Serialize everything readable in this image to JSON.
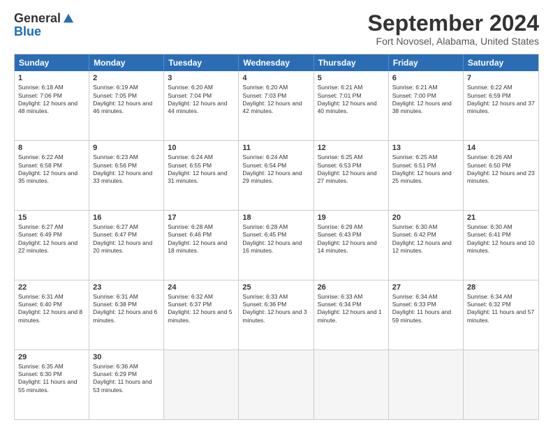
{
  "logo": {
    "general": "General",
    "blue": "Blue"
  },
  "title": "September 2024",
  "location": "Fort Novosel, Alabama, United States",
  "days": [
    "Sunday",
    "Monday",
    "Tuesday",
    "Wednesday",
    "Thursday",
    "Friday",
    "Saturday"
  ],
  "rows": [
    [
      {
        "day": "1",
        "sunrise": "Sunrise: 6:18 AM",
        "sunset": "Sunset: 7:06 PM",
        "daylight": "Daylight: 12 hours and 48 minutes."
      },
      {
        "day": "2",
        "sunrise": "Sunrise: 6:19 AM",
        "sunset": "Sunset: 7:05 PM",
        "daylight": "Daylight: 12 hours and 46 minutes."
      },
      {
        "day": "3",
        "sunrise": "Sunrise: 6:20 AM",
        "sunset": "Sunset: 7:04 PM",
        "daylight": "Daylight: 12 hours and 44 minutes."
      },
      {
        "day": "4",
        "sunrise": "Sunrise: 6:20 AM",
        "sunset": "Sunset: 7:03 PM",
        "daylight": "Daylight: 12 hours and 42 minutes."
      },
      {
        "day": "5",
        "sunrise": "Sunrise: 6:21 AM",
        "sunset": "Sunset: 7:01 PM",
        "daylight": "Daylight: 12 hours and 40 minutes."
      },
      {
        "day": "6",
        "sunrise": "Sunrise: 6:21 AM",
        "sunset": "Sunset: 7:00 PM",
        "daylight": "Daylight: 12 hours and 38 minutes."
      },
      {
        "day": "7",
        "sunrise": "Sunrise: 6:22 AM",
        "sunset": "Sunset: 6:59 PM",
        "daylight": "Daylight: 12 hours and 37 minutes."
      }
    ],
    [
      {
        "day": "8",
        "sunrise": "Sunrise: 6:22 AM",
        "sunset": "Sunset: 6:58 PM",
        "daylight": "Daylight: 12 hours and 35 minutes."
      },
      {
        "day": "9",
        "sunrise": "Sunrise: 6:23 AM",
        "sunset": "Sunset: 6:56 PM",
        "daylight": "Daylight: 12 hours and 33 minutes."
      },
      {
        "day": "10",
        "sunrise": "Sunrise: 6:24 AM",
        "sunset": "Sunset: 6:55 PM",
        "daylight": "Daylight: 12 hours and 31 minutes."
      },
      {
        "day": "11",
        "sunrise": "Sunrise: 6:24 AM",
        "sunset": "Sunset: 6:54 PM",
        "daylight": "Daylight: 12 hours and 29 minutes."
      },
      {
        "day": "12",
        "sunrise": "Sunrise: 6:25 AM",
        "sunset": "Sunset: 6:53 PM",
        "daylight": "Daylight: 12 hours and 27 minutes."
      },
      {
        "day": "13",
        "sunrise": "Sunrise: 6:25 AM",
        "sunset": "Sunset: 6:51 PM",
        "daylight": "Daylight: 12 hours and 25 minutes."
      },
      {
        "day": "14",
        "sunrise": "Sunrise: 6:26 AM",
        "sunset": "Sunset: 6:50 PM",
        "daylight": "Daylight: 12 hours and 23 minutes."
      }
    ],
    [
      {
        "day": "15",
        "sunrise": "Sunrise: 6:27 AM",
        "sunset": "Sunset: 6:49 PM",
        "daylight": "Daylight: 12 hours and 22 minutes."
      },
      {
        "day": "16",
        "sunrise": "Sunrise: 6:27 AM",
        "sunset": "Sunset: 6:47 PM",
        "daylight": "Daylight: 12 hours and 20 minutes."
      },
      {
        "day": "17",
        "sunrise": "Sunrise: 6:28 AM",
        "sunset": "Sunset: 6:46 PM",
        "daylight": "Daylight: 12 hours and 18 minutes."
      },
      {
        "day": "18",
        "sunrise": "Sunrise: 6:28 AM",
        "sunset": "Sunset: 6:45 PM",
        "daylight": "Daylight: 12 hours and 16 minutes."
      },
      {
        "day": "19",
        "sunrise": "Sunrise: 6:29 AM",
        "sunset": "Sunset: 6:43 PM",
        "daylight": "Daylight: 12 hours and 14 minutes."
      },
      {
        "day": "20",
        "sunrise": "Sunrise: 6:30 AM",
        "sunset": "Sunset: 6:42 PM",
        "daylight": "Daylight: 12 hours and 12 minutes."
      },
      {
        "day": "21",
        "sunrise": "Sunrise: 6:30 AM",
        "sunset": "Sunset: 6:41 PM",
        "daylight": "Daylight: 12 hours and 10 minutes."
      }
    ],
    [
      {
        "day": "22",
        "sunrise": "Sunrise: 6:31 AM",
        "sunset": "Sunset: 6:40 PM",
        "daylight": "Daylight: 12 hours and 8 minutes."
      },
      {
        "day": "23",
        "sunrise": "Sunrise: 6:31 AM",
        "sunset": "Sunset: 6:38 PM",
        "daylight": "Daylight: 12 hours and 6 minutes."
      },
      {
        "day": "24",
        "sunrise": "Sunrise: 6:32 AM",
        "sunset": "Sunset: 6:37 PM",
        "daylight": "Daylight: 12 hours and 5 minutes."
      },
      {
        "day": "25",
        "sunrise": "Sunrise: 6:33 AM",
        "sunset": "Sunset: 6:36 PM",
        "daylight": "Daylight: 12 hours and 3 minutes."
      },
      {
        "day": "26",
        "sunrise": "Sunrise: 6:33 AM",
        "sunset": "Sunset: 6:34 PM",
        "daylight": "Daylight: 12 hours and 1 minute."
      },
      {
        "day": "27",
        "sunrise": "Sunrise: 6:34 AM",
        "sunset": "Sunset: 6:33 PM",
        "daylight": "Daylight: 11 hours and 59 minutes."
      },
      {
        "day": "28",
        "sunrise": "Sunrise: 6:34 AM",
        "sunset": "Sunset: 6:32 PM",
        "daylight": "Daylight: 11 hours and 57 minutes."
      }
    ],
    [
      {
        "day": "29",
        "sunrise": "Sunrise: 6:35 AM",
        "sunset": "Sunset: 6:30 PM",
        "daylight": "Daylight: 11 hours and 55 minutes."
      },
      {
        "day": "30",
        "sunrise": "Sunrise: 6:36 AM",
        "sunset": "Sunset: 6:29 PM",
        "daylight": "Daylight: 11 hours and 53 minutes."
      },
      {
        "day": "",
        "sunrise": "",
        "sunset": "",
        "daylight": ""
      },
      {
        "day": "",
        "sunrise": "",
        "sunset": "",
        "daylight": ""
      },
      {
        "day": "",
        "sunrise": "",
        "sunset": "",
        "daylight": ""
      },
      {
        "day": "",
        "sunrise": "",
        "sunset": "",
        "daylight": ""
      },
      {
        "day": "",
        "sunrise": "",
        "sunset": "",
        "daylight": ""
      }
    ]
  ]
}
